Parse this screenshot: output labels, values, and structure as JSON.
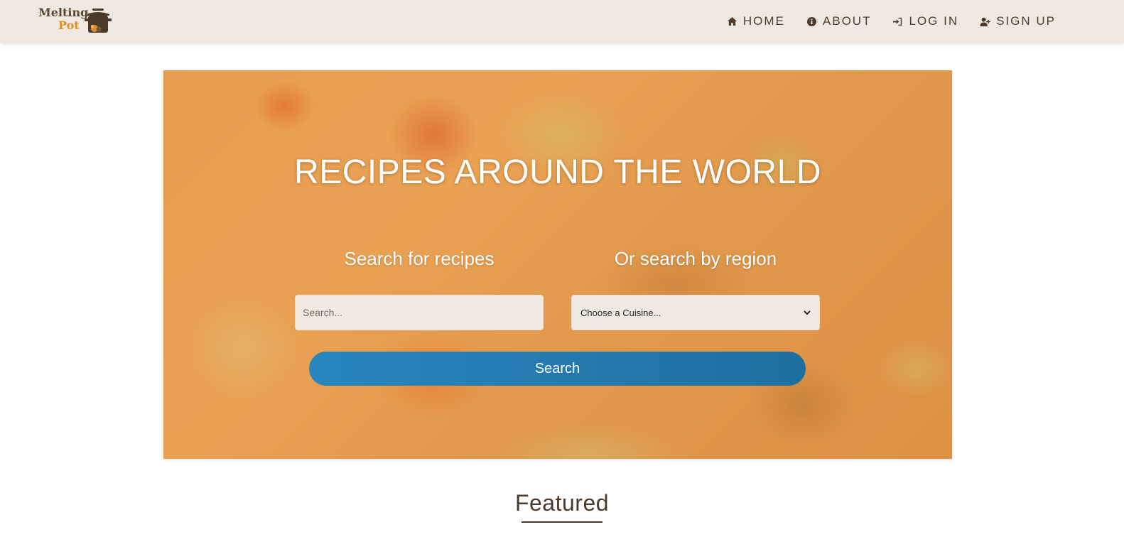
{
  "brand": {
    "name_line1": "Melting",
    "name_line2": "Pot",
    "logo_icon": "pot-icon"
  },
  "nav": {
    "items": [
      {
        "label": "HOME",
        "icon": "home-icon"
      },
      {
        "label": "ABOUT",
        "icon": "info-icon"
      },
      {
        "label": "LOG IN",
        "icon": "login-icon"
      },
      {
        "label": "SIGN UP",
        "icon": "user-plus-icon"
      }
    ]
  },
  "hero": {
    "title": "RECIPES AROUND THE WORLD",
    "search_label": "Search for recipes",
    "region_label": "Or search by region",
    "search_placeholder": "Search...",
    "cuisine_selected": "Choose a Cuisine...",
    "search_button": "Search"
  },
  "featured": {
    "title": "Featured"
  },
  "colors": {
    "navbar_bg": "#efe9e1",
    "accent_orange": "#e08e2c",
    "button_blue": "#2786be",
    "text_brown": "#4a3a2c"
  }
}
